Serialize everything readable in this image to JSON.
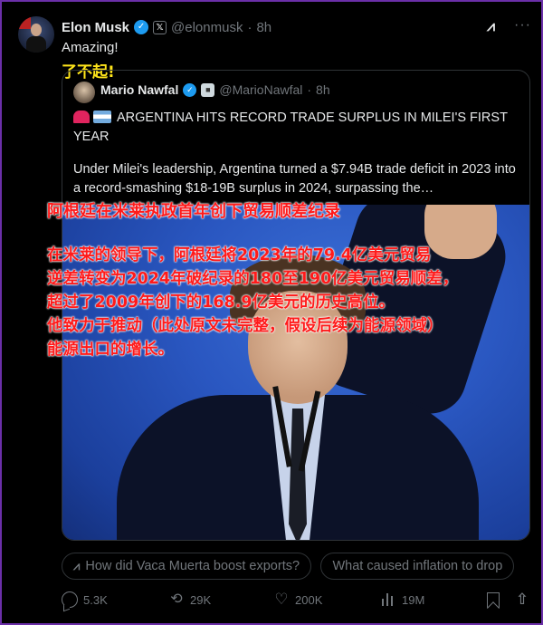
{
  "tweet": {
    "author_name": "Elon Musk",
    "handle": "@elonmusk",
    "dot": "·",
    "time": "8h",
    "text": "Amazing!",
    "translation": "了不起!"
  },
  "quoted": {
    "author_name": "Mario Nawfal",
    "handle": "@MarioNawfal",
    "dot": "·",
    "time": "8h",
    "title": "ARGENTINA HITS RECORD TRADE SURPLUS IN MILEI'S FIRST YEAR",
    "body": "Under Milei's leadership, Argentina turned a $7.94B trade deficit in 2023 into a record-smashing $18-19B surplus in 2024, surpassing the…"
  },
  "overlay_translation": {
    "title": "阿根廷在米莱执政首年创下贸易顺差纪录",
    "lines": [
      "在米莱的领导下，阿根廷将2023年的79.4亿美元贸易",
      "逆差转变为2024年破纪录的180至190亿美元贸易顺差，",
      "超过了2009年创下的168.9亿美元的历史高位。",
      "他致力于推动（此处原文未完整，假设后续为能源领域）",
      "能源出口的增长。"
    ]
  },
  "grok_chips": [
    "How did Vaca Muerta boost exports?",
    "What caused inflation to drop"
  ],
  "actions": {
    "replies": "5.3K",
    "reposts": "29K",
    "likes": "200K",
    "views": "19M"
  },
  "icons": {
    "verified": "verified-check-icon",
    "x_affiliate": "x-logo-icon",
    "grok": "grok-icon",
    "more": "more-dots-icon",
    "reply": "reply-icon",
    "repost": "repost-icon",
    "like": "heart-icon",
    "views": "bar-chart-icon",
    "bookmark": "bookmark-icon",
    "share": "share-icon"
  },
  "colors": {
    "background": "#000000",
    "verified_blue": "#1d9bf0",
    "muted_text": "#71767b",
    "translation_yellow": "#ffe51a",
    "translation_red": "#ff1a1a"
  }
}
